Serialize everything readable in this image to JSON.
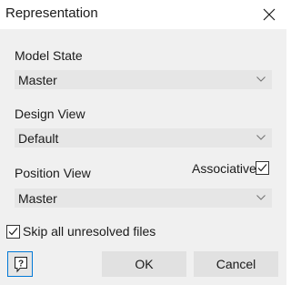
{
  "window": {
    "title": "Representation"
  },
  "model_state": {
    "label": "Model State",
    "value": "Master"
  },
  "design_view": {
    "label": "Design View",
    "value": "Default"
  },
  "position_view": {
    "label": "Position View",
    "value": "Master"
  },
  "associative": {
    "label": "Associative",
    "checked": true
  },
  "skip_unresolved": {
    "label": "Skip all unresolved files",
    "checked": true
  },
  "buttons": {
    "ok": "OK",
    "cancel": "Cancel"
  },
  "icons": {
    "close": "close-icon",
    "chevron": "chevron-down-icon",
    "check": "checkmark-icon",
    "help": "help-icon"
  },
  "colors": {
    "panel": "#f0f0f0",
    "field": "#e6e6e6",
    "button": "#e1e1e1",
    "focus_border": "#0078d7"
  }
}
